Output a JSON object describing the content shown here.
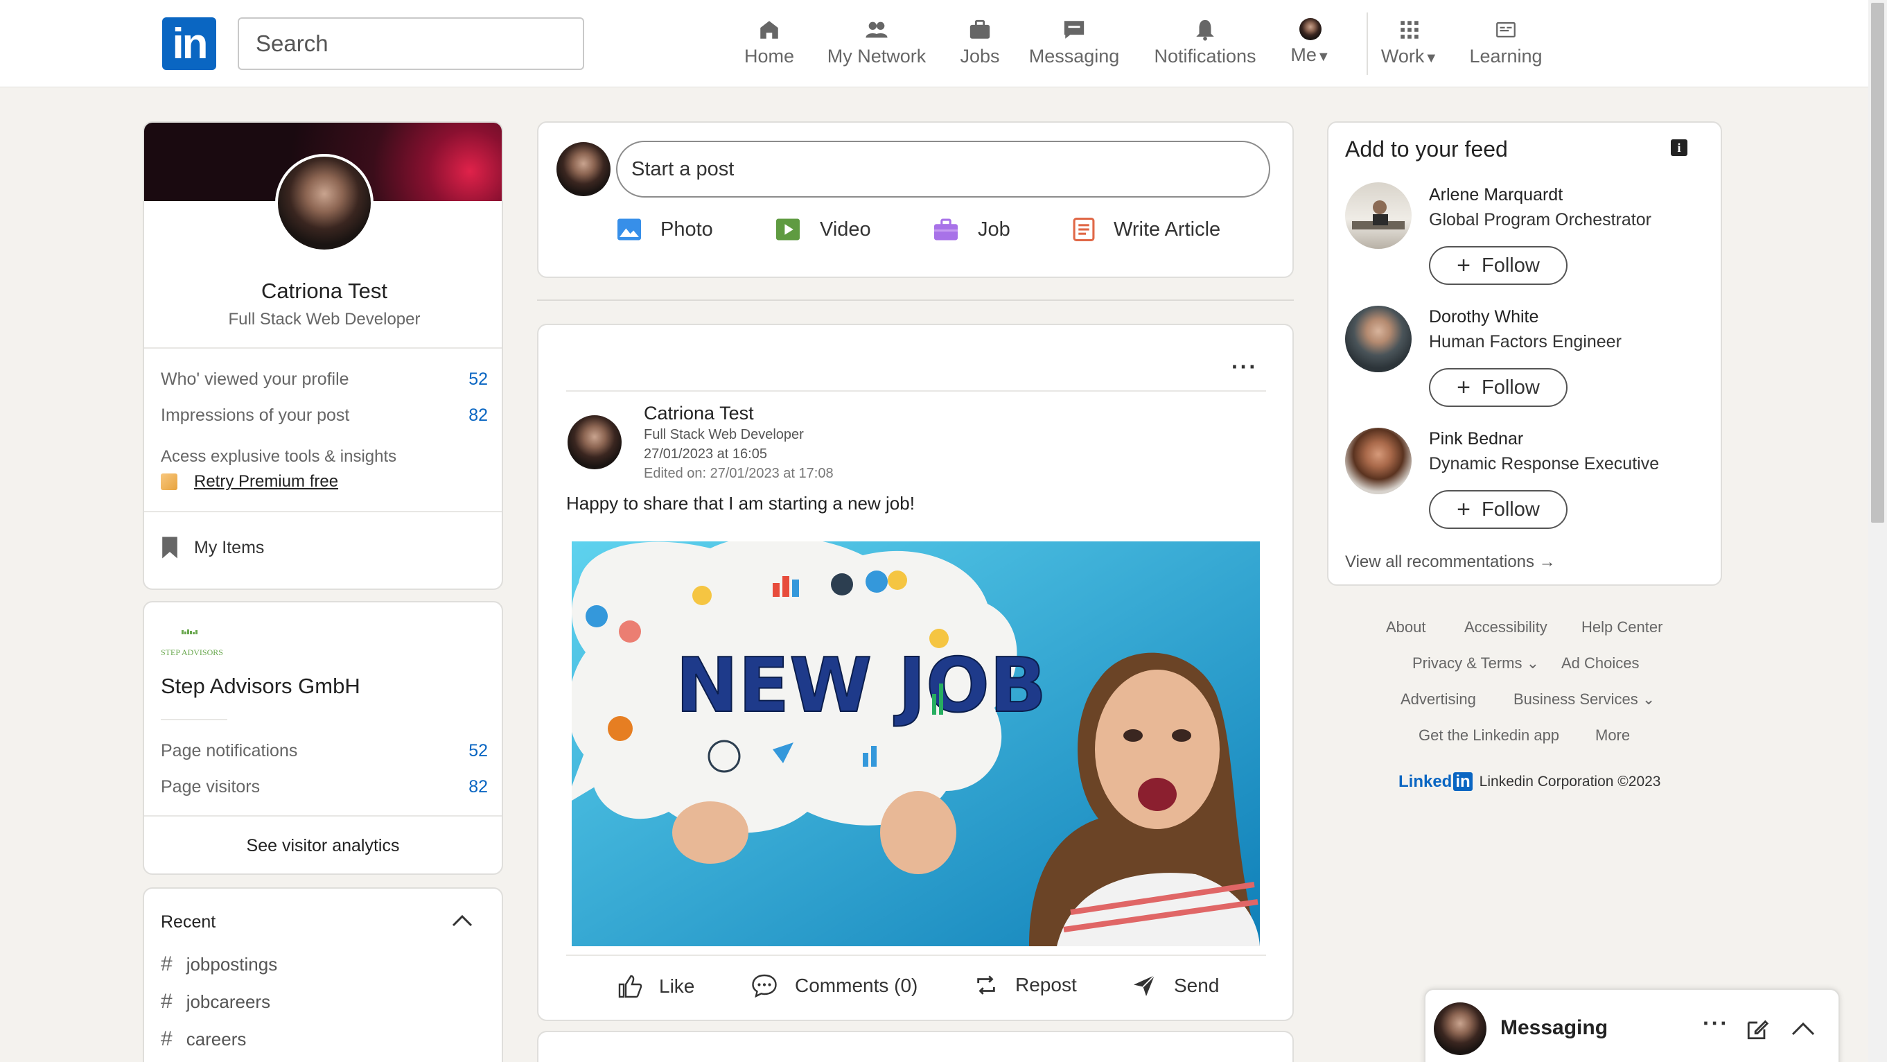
{
  "header": {
    "logo_text": "in",
    "search_placeholder": "Search",
    "nav": [
      {
        "label": "Home"
      },
      {
        "label": "My Network"
      },
      {
        "label": "Jobs"
      },
      {
        "label": "Messaging"
      },
      {
        "label": "Notifications"
      },
      {
        "label": "Me"
      },
      {
        "label": "Work"
      },
      {
        "label": "Learning"
      }
    ]
  },
  "profile": {
    "name": "Catriona Test",
    "headline": "Full Stack Web Developer",
    "stats": [
      {
        "label": "Who' viewed your profile",
        "value": "52"
      },
      {
        "label": "Impressions of your post",
        "value": "82"
      }
    ],
    "premium_text": "Acess explusive tools & insights",
    "premium_link": "Retry Premium free",
    "my_items": "My Items"
  },
  "company": {
    "logo_text": "STEP ADVISORS",
    "name": "Step Advisors GmbH",
    "stats": [
      {
        "label": "Page notifications",
        "value": "52"
      },
      {
        "label": "Page visitors",
        "value": "82"
      }
    ],
    "analytics_link": "See visitor analytics"
  },
  "recent": {
    "title": "Recent",
    "items": [
      "jobpostings",
      "jobcareers",
      "careers"
    ]
  },
  "composer": {
    "placeholder": "Start a post",
    "actions": [
      {
        "label": "Photo",
        "icon": "photo-icon",
        "color": "#378fe9"
      },
      {
        "label": "Video",
        "icon": "video-icon",
        "color": "#5f9b41"
      },
      {
        "label": "Job",
        "icon": "job-icon",
        "color": "#a872e8"
      },
      {
        "label": "Write Article",
        "icon": "article-icon",
        "color": "#e06847"
      }
    ]
  },
  "post": {
    "author": "Catriona Test",
    "headline": "Full Stack Web Developer",
    "date": "27/01/2023 at 16:05",
    "edited": "Edited on: 27/01/2023 at 17:08",
    "text": "Happy to share that I am starting a new job!",
    "image_text": "NEW JOB",
    "actions": [
      {
        "label": "Like"
      },
      {
        "label": "Comments (0)"
      },
      {
        "label": "Repost"
      },
      {
        "label": "Send"
      }
    ]
  },
  "feed": {
    "title": "Add to your feed",
    "follow_label": "Follow",
    "recommendations": [
      {
        "name": "Arlene Marquardt",
        "title": "Global Program Orchestrator"
      },
      {
        "name": "Dorothy White",
        "title": "Human Factors Engineer"
      },
      {
        "name": "Pink Bednar",
        "title": "Dynamic Response Executive"
      }
    ],
    "view_all": "View all recommentations →"
  },
  "footer": {
    "links": [
      "About",
      "Accessibility",
      "Help Center",
      "Privacy & Terms ⌄",
      "Ad Choices",
      "Advertising",
      "Business Services ⌄",
      "Get the Linkedin app",
      "More"
    ],
    "brand_text": "Linked",
    "brand_box": "in",
    "copyright": "Linkedin Corporation ©2023"
  },
  "messaging": {
    "title": "Messaging"
  },
  "colors": {
    "brand": "#0a66c2",
    "background": "#f4f2ee"
  }
}
